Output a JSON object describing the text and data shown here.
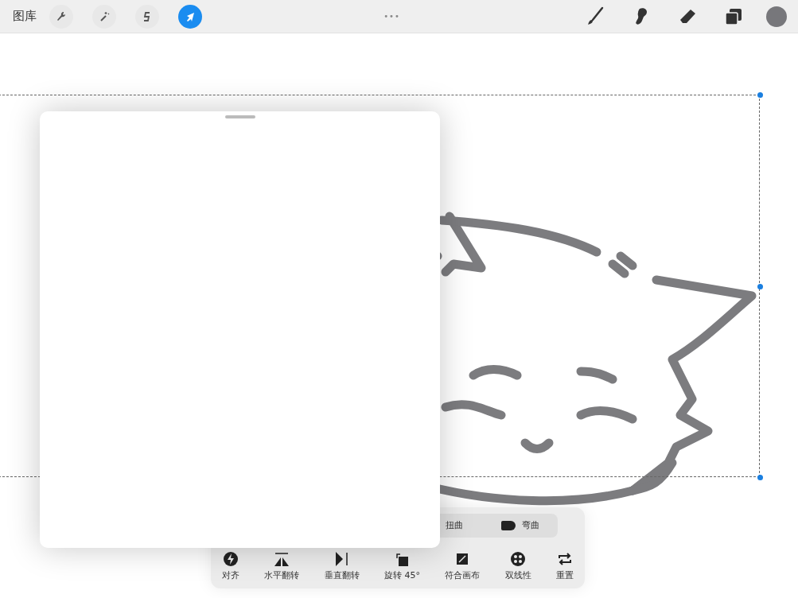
{
  "top_bar": {
    "gallery": "图库",
    "left_tools": [
      {
        "selected": false
      },
      {
        "selected": false
      },
      {
        "selected": false
      },
      {
        "selected": true
      }
    ],
    "more": "•••",
    "right_tools": [
      {
        "selected": false
      },
      {
        "selected": false
      },
      {
        "selected": false
      },
      {
        "selected": false
      }
    ]
  },
  "transform_modes": [
    {
      "label": "扭曲"
    },
    {
      "label": "弯曲"
    }
  ],
  "transform_actions": [
    {
      "label": "对齐"
    },
    {
      "label": "水平翻转"
    },
    {
      "label": "垂直翻转"
    },
    {
      "label": "旋转 45°"
    },
    {
      "label": "符合画布"
    },
    {
      "label": "双线性"
    },
    {
      "label": "重置"
    }
  ]
}
